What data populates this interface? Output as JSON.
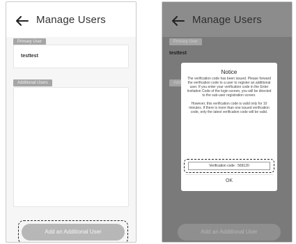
{
  "left_screen": {
    "title": "Manage Users",
    "primary_section_label": "Primary User",
    "primary_user_name": "testtest",
    "additional_section_label": "Additional Users",
    "add_button_label": "Add an Additional User"
  },
  "right_screen": {
    "title": "Manage Users",
    "primary_section_label": "Primary User",
    "primary_user_name": "testtest",
    "additional_section_label": "Additional Users",
    "add_button_label": "Add an Additional User",
    "dialog": {
      "title": "Notice",
      "paragraph1": "The verification code has been issued. Please forward the verification code to a user to register an additional user. If you enter your verification code in the Enter Invitation Code of the login screen, you will be directed to the sub-user registration screen.",
      "paragraph2": "However, this verification code is valid only for 10 minutes. If there is more than one issued verification code, only the latest verification code will be valid.",
      "code_text": "Verification code : 569120",
      "ok_label": "OK"
    }
  },
  "icons": {
    "back": "back-arrow-icon"
  }
}
